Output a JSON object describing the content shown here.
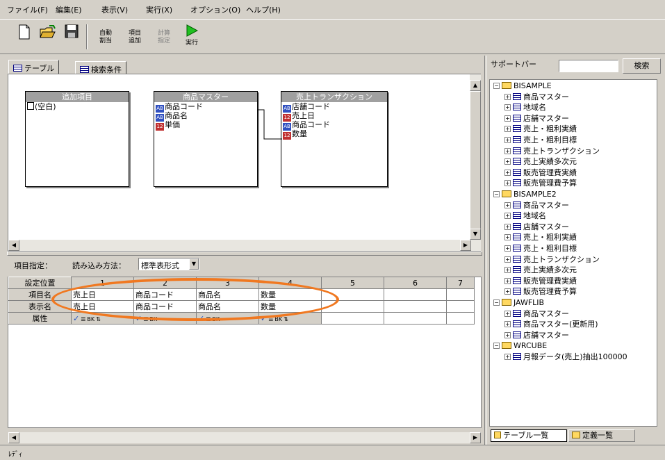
{
  "menu": [
    "ファイル(F)",
    "編集(E)",
    "表示(V)",
    "実行(X)",
    "オプション(O)",
    "ヘルプ(H)"
  ],
  "toolbar": {
    "auto_assign": [
      "自動",
      "割当"
    ],
    "add_item": [
      "項目",
      "追加"
    ],
    "calc_spec": [
      "計算",
      "指定"
    ],
    "run": "実行"
  },
  "tabs": [
    "テーブル",
    "検索条件"
  ],
  "tables": [
    {
      "title": "追加項目",
      "fields": [
        "(空白)"
      ]
    },
    {
      "title": "商品マスター",
      "fields": [
        "商品コード",
        "商品名",
        "単価"
      ]
    },
    {
      "title": "売上トランザクション",
      "fields": [
        "店舗コード",
        "売上日",
        "商品コード",
        "数量"
      ]
    }
  ],
  "props": {
    "label": "項目指定：",
    "load_method_label": "読み込み方法：",
    "load_method_value": "標準表形式"
  },
  "grid": {
    "row_headers": [
      "設定位置",
      "項目名",
      "表示名",
      "属性"
    ],
    "columns": [
      "1",
      "2",
      "3",
      "4",
      "5",
      "6",
      "7"
    ],
    "item_names": [
      "売上日",
      "商品コード",
      "商品名",
      "数量"
    ],
    "display_names": [
      "売上日",
      "商品コード",
      "商品名",
      "数量"
    ],
    "attr_bk": "BK"
  },
  "support": {
    "title": "サポートバー",
    "search_button": "検索",
    "search_value": ""
  },
  "tree": [
    {
      "folder": "BISAMPLE",
      "items": [
        "商品マスター",
        "地域名",
        "店舗マスター",
        "売上・粗利実績",
        "売上・粗利目標",
        "売上トランザクション",
        "売上実績多次元",
        "販売管理費実績",
        "販売管理費予算"
      ]
    },
    {
      "folder": "BISAMPLE2",
      "items": [
        "商品マスター",
        "地域名",
        "店舗マスター",
        "売上・粗利実績",
        "売上・粗利目標",
        "売上トランザクション",
        "売上実績多次元",
        "販売管理費実績",
        "販売管理費予算"
      ]
    },
    {
      "folder": "JAWFLIB",
      "items": [
        "商品マスター",
        "商品マスター(更新用)",
        "店舗マスター"
      ]
    },
    {
      "folder": "WRCUBE",
      "items": [
        "月報データ(売上)抽出100000"
      ]
    }
  ],
  "bottom_tabs": [
    "テーブル一覧",
    "定義一覧"
  ],
  "status": "ﾚﾃﾞｨ"
}
